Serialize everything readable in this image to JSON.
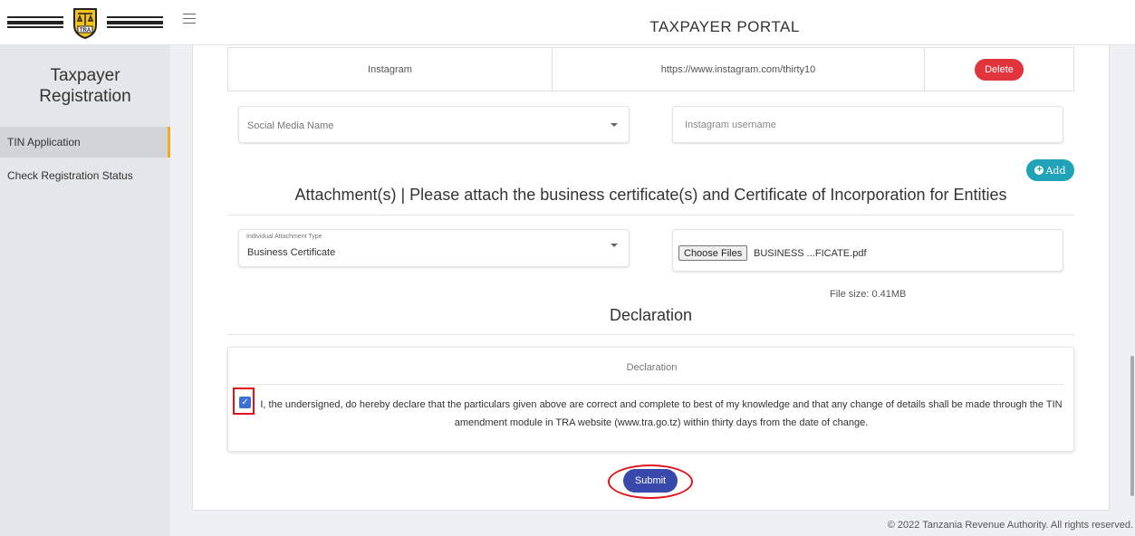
{
  "header": {
    "portal_title": "TAXPAYER PORTAL",
    "logo_text": "TRA"
  },
  "sidebar": {
    "title": "Taxpayer Registration",
    "items": [
      {
        "label": "TIN Application",
        "active": true
      },
      {
        "label": "Check Registration Status",
        "active": false
      }
    ]
  },
  "social_media": {
    "rows": [
      {
        "name": "Instagram",
        "url": "https://www.instagram.com/thirty10",
        "delete_label": "Delete"
      }
    ],
    "name_select_placeholder": "Social Media Name",
    "username_placeholder": "Instagram username",
    "add_label": "Add"
  },
  "attachments": {
    "heading": "Attachment(s) | Please attach the business certificate(s) and Certificate of Incorporation for Entities",
    "type_label": "Individual Attachment Type",
    "type_value": "Business Certificate",
    "choose_files_label": "Choose Files",
    "file_name": "BUSINESS ...FICATE.pdf",
    "file_size": "File size: 0.41MB"
  },
  "declaration": {
    "heading": "Declaration",
    "card_title": "Declaration",
    "text": "I, the undersigned, do hereby declare that the particulars given above are correct and complete to best of my knowledge and that any change of details shall be made through the TIN amendment module in TRA website (www.tra.go.tz) within thirty days from the date of change.",
    "checked": true,
    "submit_label": "Submit"
  },
  "footer": {
    "text": "© 2022 Tanzania Revenue Authority. All rights reserved."
  },
  "colors": {
    "delete": "#e0333c",
    "add": "#20a3b8",
    "submit": "#3949ab",
    "checkbox": "#3d70d6",
    "active_indicator": "#f0ad1f",
    "highlight": "#e0131a"
  }
}
